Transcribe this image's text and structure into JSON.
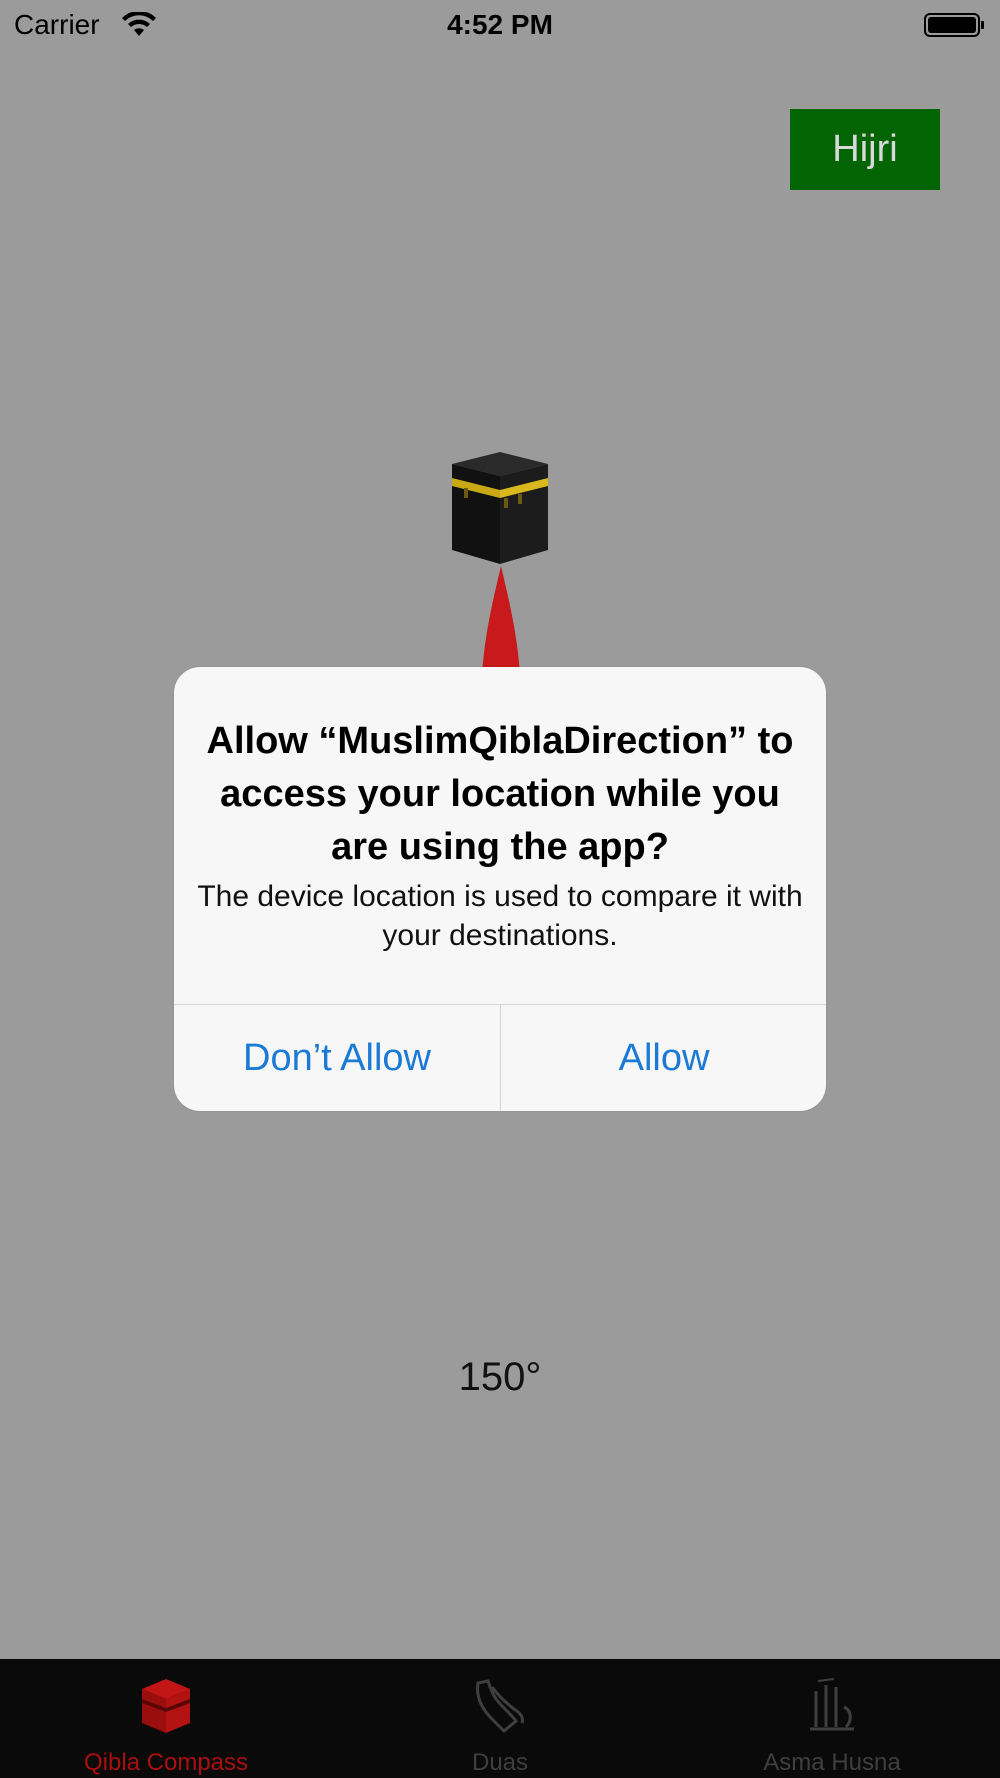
{
  "status_bar": {
    "carrier": "Carrier",
    "time": "4:52 PM"
  },
  "header": {
    "hijri_label": "Hijri",
    "hijri_color": "#036403"
  },
  "compass": {
    "degree": "150°",
    "kaaba_icon": "kaaba-icon",
    "needle_color": "#c8191c"
  },
  "alert": {
    "title": "Allow “MuslimQiblaDirection” to access your location while you are using the app?",
    "message": "The device location is used to compare it with your destinations.",
    "buttons": [
      {
        "label": "Don’t Allow"
      },
      {
        "label": "Allow"
      }
    ],
    "button_color": "#1a7ad6"
  },
  "tab_bar": {
    "tabs": [
      {
        "label": "Qibla Compass",
        "icon": "kaaba-icon",
        "active": true
      },
      {
        "label": "Duas",
        "icon": "praying-hands-icon",
        "active": false
      },
      {
        "label": "Asma Husna",
        "icon": "calligraphy-icon",
        "active": false
      }
    ],
    "active_color": "#a90f0f"
  }
}
